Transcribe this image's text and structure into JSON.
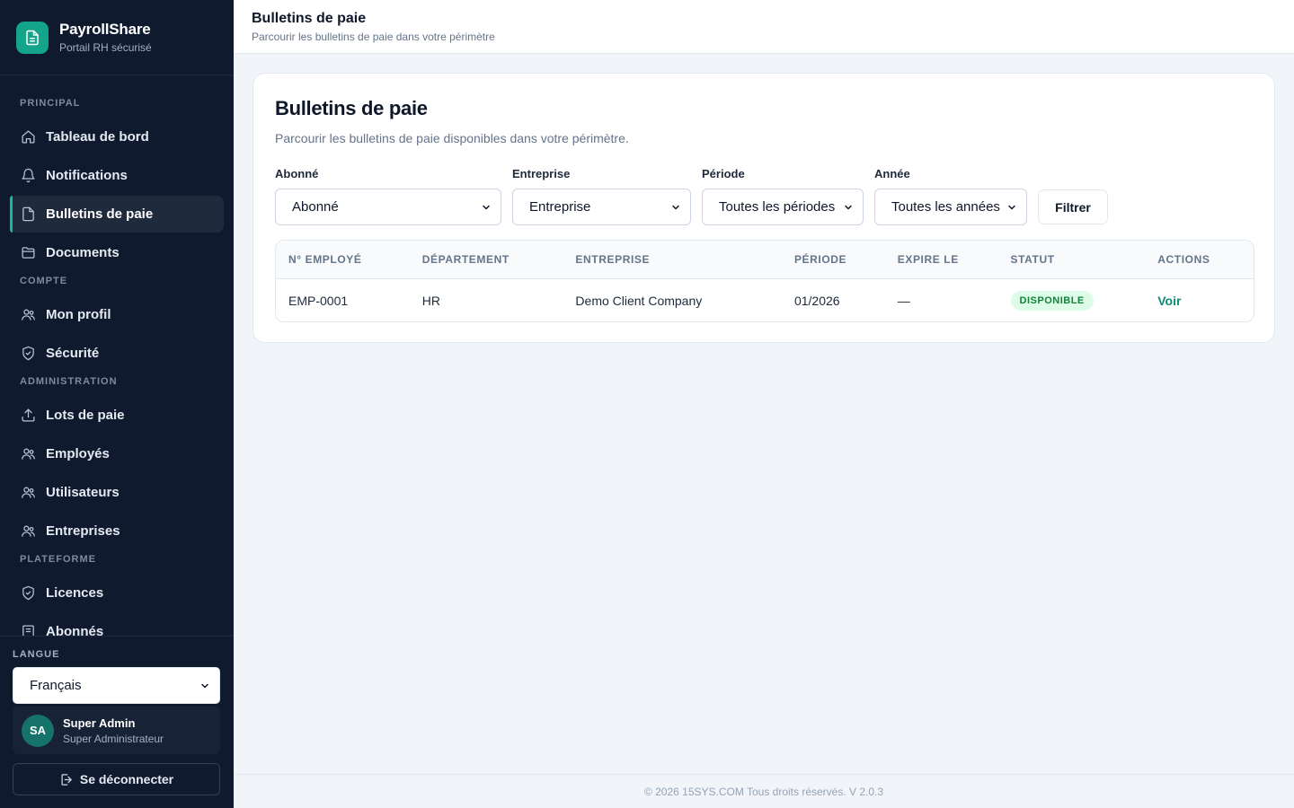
{
  "brand": {
    "title": "PayrollShare",
    "subtitle": "Portail RH sécurisé"
  },
  "nav": {
    "sections": [
      {
        "label": "PRINCIPAL",
        "items": [
          "Tableau de bord",
          "Notifications",
          "Bulletins de paie",
          "Documents"
        ]
      },
      {
        "label": "COMPTE",
        "items": [
          "Mon profil",
          "Sécurité"
        ]
      },
      {
        "label": "ADMINISTRATION",
        "items": [
          "Lots de paie",
          "Employés",
          "Utilisateurs",
          "Entreprises"
        ]
      },
      {
        "label": "PLATEFORME",
        "items": [
          "Licences",
          "Abonnés"
        ]
      }
    ],
    "active": "Bulletins de paie"
  },
  "language": {
    "label": "LANGUE",
    "selected": "Français"
  },
  "user": {
    "initials": "SA",
    "name": "Super Admin",
    "role": "Super Administrateur"
  },
  "logout_label": "Se déconnecter",
  "topbar": {
    "title": "Bulletins de paie",
    "subtitle": "Parcourir les bulletins de paie dans votre périmètre"
  },
  "card": {
    "title": "Bulletins de paie",
    "subtitle": "Parcourir les bulletins de paie disponibles dans votre périmètre."
  },
  "filters": {
    "subscriber": {
      "label": "Abonné",
      "value": "Abonné"
    },
    "company": {
      "label": "Entreprise",
      "value": "Entreprise"
    },
    "period": {
      "label": "Période",
      "value": "Toutes les périodes"
    },
    "year": {
      "label": "Année",
      "value": "Toutes les années"
    },
    "button": "Filtrer"
  },
  "table": {
    "columns": [
      "N° EMPLOYÉ",
      "DÉPARTEMENT",
      "ENTREPRISE",
      "PÉRIODE",
      "EXPIRE LE",
      "STATUT",
      "ACTIONS"
    ],
    "rows": [
      {
        "employee_no": "EMP-0001",
        "department": "HR",
        "company": "Demo Client Company",
        "period": "01/2026",
        "expires": "—",
        "status": "DISPONIBLE",
        "action": "Voir"
      }
    ]
  },
  "footer": "© 2026 15SYS.COM Tous droits réservés. V 2.0.3",
  "colors": {
    "sidebar": "#0f1a2e",
    "accent": "#14a38b",
    "status_bg": "#dcfce7",
    "status_text": "#15803d"
  }
}
